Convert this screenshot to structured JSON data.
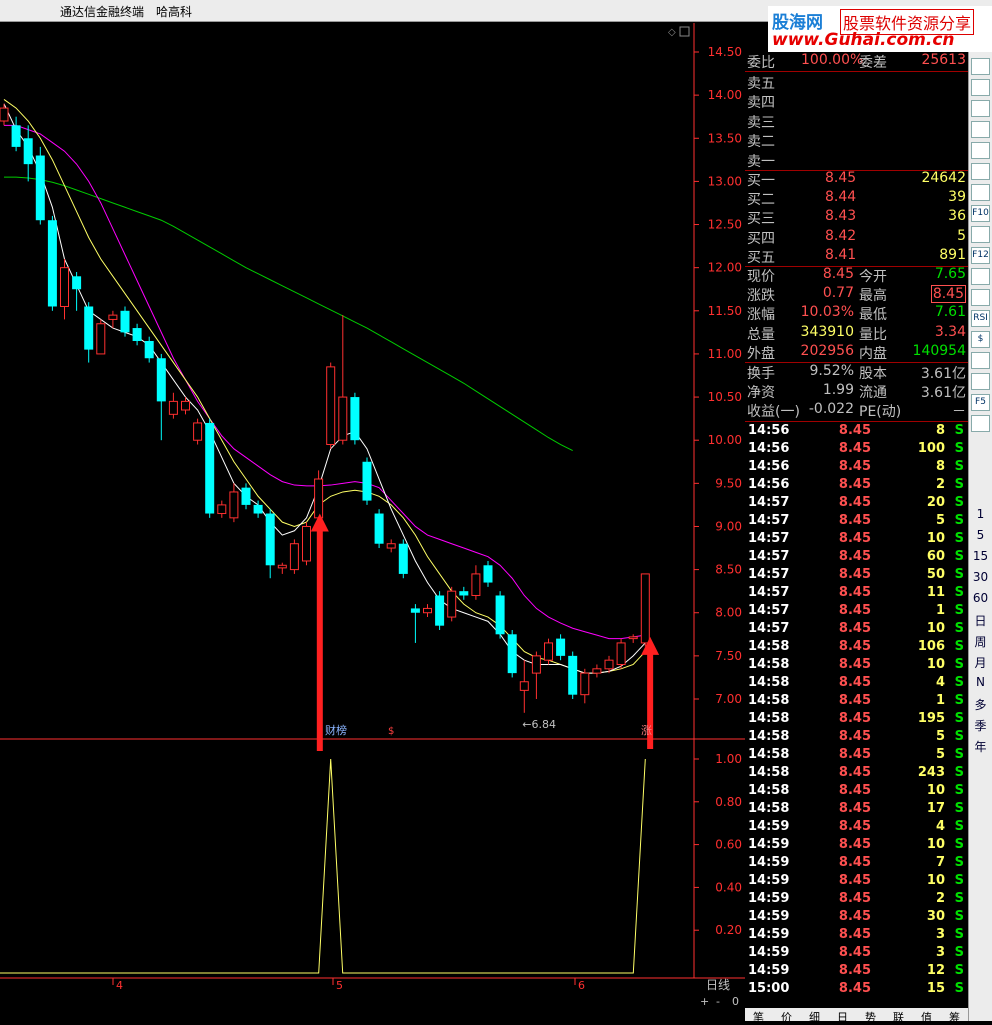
{
  "titlebar": {
    "app": "通达信金融终端",
    "stock": "哈高科"
  },
  "watermark": {
    "brand": "股海网",
    "tag": "股票软件资源分享",
    "url": "www.Guhai.com.cn"
  },
  "price_axis": [
    "14.50",
    "14.00",
    "13.50",
    "13.00",
    "12.50",
    "12.00",
    "11.50",
    "11.00",
    "10.50",
    "10.00",
    "9.50",
    "9.00",
    "8.50",
    "8.00",
    "7.50",
    "7.00"
  ],
  "indicator_axis": [
    "1.00",
    "0.80",
    "0.60",
    "0.40",
    "0.20"
  ],
  "date_axis": [
    "4",
    "5",
    "6"
  ],
  "period_label": "日线",
  "annotations": {
    "low_label": "←6.84",
    "signal_1": "财榜",
    "signal_2": "$",
    "signal_3": "涨"
  },
  "zoom_controls": {
    "plus": "+",
    "minus": "-",
    "zero": "0"
  },
  "quote": {
    "weibi": {
      "label": "委比",
      "value": "100.00%",
      "label2": "委差",
      "value2": "25613"
    },
    "sell": [
      {
        "label": "卖五"
      },
      {
        "label": "卖四"
      },
      {
        "label": "卖三"
      },
      {
        "label": "卖二"
      },
      {
        "label": "卖一"
      }
    ],
    "buy": [
      {
        "label": "买一",
        "price": "8.45",
        "vol": "24642"
      },
      {
        "label": "买二",
        "price": "8.44",
        "vol": "39"
      },
      {
        "label": "买三",
        "price": "8.43",
        "vol": "36"
      },
      {
        "label": "买四",
        "price": "8.42",
        "vol": "5"
      },
      {
        "label": "买五",
        "price": "8.41",
        "vol": "891"
      }
    ],
    "stats": [
      {
        "l1": "现价",
        "v1": "8.45",
        "l2": "今开",
        "v2": "7.65"
      },
      {
        "l1": "涨跌",
        "v1": "0.77",
        "l2": "最高",
        "v2": "8.45"
      },
      {
        "l1": "涨幅",
        "v1": "10.03%",
        "l2": "最低",
        "v2": "7.61"
      },
      {
        "l1": "总量",
        "v1": "343910",
        "l2": "量比",
        "v2": "3.34"
      },
      {
        "l1": "外盘",
        "v1": "202956",
        "l2": "内盘",
        "v2": "140954"
      }
    ],
    "fund": [
      {
        "l1": "换手",
        "v1": "9.52%",
        "l2": "股本",
        "v2": "3.61亿"
      },
      {
        "l1": "净资",
        "v1": "1.99",
        "l2": "流通",
        "v2": "3.61亿"
      },
      {
        "l1": "收益(一)",
        "v1": "-0.022",
        "l2": "PE(动)",
        "v2": "－"
      }
    ]
  },
  "ticks": [
    {
      "t": "14:56",
      "p": "8.45",
      "v": "8",
      "s": "S"
    },
    {
      "t": "14:56",
      "p": "8.45",
      "v": "100",
      "s": "S"
    },
    {
      "t": "14:56",
      "p": "8.45",
      "v": "8",
      "s": "S"
    },
    {
      "t": "14:56",
      "p": "8.45",
      "v": "2",
      "s": "S"
    },
    {
      "t": "14:57",
      "p": "8.45",
      "v": "20",
      "s": "S"
    },
    {
      "t": "14:57",
      "p": "8.45",
      "v": "5",
      "s": "S"
    },
    {
      "t": "14:57",
      "p": "8.45",
      "v": "10",
      "s": "S"
    },
    {
      "t": "14:57",
      "p": "8.45",
      "v": "60",
      "s": "S"
    },
    {
      "t": "14:57",
      "p": "8.45",
      "v": "50",
      "s": "S"
    },
    {
      "t": "14:57",
      "p": "8.45",
      "v": "11",
      "s": "S"
    },
    {
      "t": "14:57",
      "p": "8.45",
      "v": "1",
      "s": "S"
    },
    {
      "t": "14:57",
      "p": "8.45",
      "v": "10",
      "s": "S"
    },
    {
      "t": "14:58",
      "p": "8.45",
      "v": "106",
      "s": "S"
    },
    {
      "t": "14:58",
      "p": "8.45",
      "v": "10",
      "s": "S"
    },
    {
      "t": "14:58",
      "p": "8.45",
      "v": "4",
      "s": "S"
    },
    {
      "t": "14:58",
      "p": "8.45",
      "v": "1",
      "s": "S"
    },
    {
      "t": "14:58",
      "p": "8.45",
      "v": "195",
      "s": "S"
    },
    {
      "t": "14:58",
      "p": "8.45",
      "v": "5",
      "s": "S"
    },
    {
      "t": "14:58",
      "p": "8.45",
      "v": "5",
      "s": "S"
    },
    {
      "t": "14:58",
      "p": "8.45",
      "v": "243",
      "s": "S"
    },
    {
      "t": "14:58",
      "p": "8.45",
      "v": "10",
      "s": "S"
    },
    {
      "t": "14:58",
      "p": "8.45",
      "v": "17",
      "s": "S"
    },
    {
      "t": "14:59",
      "p": "8.45",
      "v": "4",
      "s": "S"
    },
    {
      "t": "14:59",
      "p": "8.45",
      "v": "10",
      "s": "S"
    },
    {
      "t": "14:59",
      "p": "8.45",
      "v": "7",
      "s": "S"
    },
    {
      "t": "14:59",
      "p": "8.45",
      "v": "10",
      "s": "S"
    },
    {
      "t": "14:59",
      "p": "8.45",
      "v": "2",
      "s": "S"
    },
    {
      "t": "14:59",
      "p": "8.45",
      "v": "30",
      "s": "S"
    },
    {
      "t": "14:59",
      "p": "8.45",
      "v": "3",
      "s": "S"
    },
    {
      "t": "14:59",
      "p": "8.45",
      "v": "3",
      "s": "S"
    },
    {
      "t": "14:59",
      "p": "8.45",
      "v": "12",
      "s": "S"
    },
    {
      "t": "15:00",
      "p": "8.45",
      "v": "15",
      "s": "S"
    }
  ],
  "toolbar": {
    "icons": [
      "refresh-icon",
      "kline-icon",
      "table-icon",
      "list-icon",
      "trend-icon",
      "chart-icon",
      "doc-icon",
      "f10-icon",
      "info-icon",
      "f12-icon",
      "circle-icon",
      "wave-icon",
      "rsi-icon",
      "money-icon",
      "move-icon",
      "pen-icon",
      "f5-icon",
      "cycle-icon"
    ],
    "icon_labels": [
      "",
      "",
      "",
      "",
      "",
      "",
      "",
      "F10",
      "",
      "F12",
      "",
      "",
      "RSI",
      "$",
      "",
      "",
      "F5",
      ""
    ],
    "periods": [
      "1",
      "5",
      "15",
      "30",
      "60",
      "日",
      "周",
      "月",
      "N",
      "多",
      "季",
      "年"
    ]
  },
  "bottom_tabs": [
    "笔",
    "价",
    "细",
    "日",
    "势",
    "联",
    "值",
    "筹"
  ],
  "chart_data": {
    "type": "candlestick",
    "ylim": [
      6.8,
      14.6
    ],
    "candles": [
      {
        "o": 13.7,
        "c": 13.85,
        "h": 13.9,
        "l": 13.65
      },
      {
        "o": 13.65,
        "c": 13.4,
        "h": 13.75,
        "l": 13.35
      },
      {
        "o": 13.5,
        "c": 13.2,
        "h": 13.65,
        "l": 13.0
      },
      {
        "o": 13.3,
        "c": 12.55,
        "h": 13.4,
        "l": 12.5
      },
      {
        "o": 12.55,
        "c": 11.55,
        "h": 12.6,
        "l": 11.5
      },
      {
        "o": 11.55,
        "c": 12.0,
        "h": 12.1,
        "l": 11.4
      },
      {
        "o": 11.9,
        "c": 11.75,
        "h": 11.95,
        "l": 11.5
      },
      {
        "o": 11.55,
        "c": 11.05,
        "h": 11.6,
        "l": 10.9
      },
      {
        "o": 11.0,
        "c": 11.35,
        "h": 11.4,
        "l": 11.0
      },
      {
        "o": 11.4,
        "c": 11.45,
        "h": 11.5,
        "l": 11.3
      },
      {
        "o": 11.5,
        "c": 11.25,
        "h": 11.55,
        "l": 11.2
      },
      {
        "o": 11.3,
        "c": 11.15,
        "h": 11.35,
        "l": 11.1
      },
      {
        "o": 11.15,
        "c": 10.95,
        "h": 11.2,
        "l": 10.9
      },
      {
        "o": 10.95,
        "c": 10.45,
        "h": 11.0,
        "l": 10.0
      },
      {
        "o": 10.3,
        "c": 10.45,
        "h": 10.55,
        "l": 10.25
      },
      {
        "o": 10.35,
        "c": 10.45,
        "h": 10.5,
        "l": 10.3
      },
      {
        "o": 10.0,
        "c": 10.2,
        "h": 10.25,
        "l": 9.95
      },
      {
        "o": 10.2,
        "c": 9.15,
        "h": 10.25,
        "l": 9.1
      },
      {
        "o": 9.15,
        "c": 9.25,
        "h": 9.3,
        "l": 9.1
      },
      {
        "o": 9.1,
        "c": 9.4,
        "h": 9.5,
        "l": 9.05
      },
      {
        "o": 9.45,
        "c": 9.25,
        "h": 9.5,
        "l": 9.2
      },
      {
        "o": 9.25,
        "c": 9.15,
        "h": 9.3,
        "l": 9.1
      },
      {
        "o": 9.15,
        "c": 8.55,
        "h": 9.2,
        "l": 8.4
      },
      {
        "o": 8.52,
        "c": 8.55,
        "h": 8.58,
        "l": 8.45
      },
      {
        "o": 8.5,
        "c": 8.8,
        "h": 8.85,
        "l": 8.45
      },
      {
        "o": 8.6,
        "c": 9.0,
        "h": 9.05,
        "l": 8.55
      },
      {
        "o": 9.1,
        "c": 9.55,
        "h": 9.65,
        "l": 9.05
      },
      {
        "o": 9.95,
        "c": 10.85,
        "h": 10.9,
        "l": 9.9
      },
      {
        "o": 10.0,
        "c": 10.5,
        "h": 11.45,
        "l": 9.95
      },
      {
        "o": 10.5,
        "c": 10.0,
        "h": 10.55,
        "l": 9.95
      },
      {
        "o": 9.75,
        "c": 9.3,
        "h": 9.8,
        "l": 9.25
      },
      {
        "o": 9.15,
        "c": 8.8,
        "h": 9.2,
        "l": 8.75
      },
      {
        "o": 8.75,
        "c": 8.8,
        "h": 8.85,
        "l": 8.7
      },
      {
        "o": 8.8,
        "c": 8.45,
        "h": 8.85,
        "l": 8.4
      },
      {
        "o": 8.05,
        "c": 8.0,
        "h": 8.1,
        "l": 7.65
      },
      {
        "o": 8.0,
        "c": 8.05,
        "h": 8.1,
        "l": 7.95
      },
      {
        "o": 8.2,
        "c": 7.85,
        "h": 8.25,
        "l": 7.8
      },
      {
        "o": 7.95,
        "c": 8.25,
        "h": 8.3,
        "l": 7.9
      },
      {
        "o": 8.25,
        "c": 8.2,
        "h": 8.3,
        "l": 8.15
      },
      {
        "o": 8.2,
        "c": 8.45,
        "h": 8.55,
        "l": 8.15
      },
      {
        "o": 8.55,
        "c": 8.35,
        "h": 8.6,
        "l": 8.3
      },
      {
        "o": 8.2,
        "c": 7.75,
        "h": 8.25,
        "l": 7.7
      },
      {
        "o": 7.75,
        "c": 7.3,
        "h": 7.8,
        "l": 7.25
      },
      {
        "o": 7.1,
        "c": 7.2,
        "h": 7.45,
        "l": 6.84
      },
      {
        "o": 7.3,
        "c": 7.5,
        "h": 7.55,
        "l": 7.0
      },
      {
        "o": 7.45,
        "c": 7.65,
        "h": 7.7,
        "l": 7.4
      },
      {
        "o": 7.7,
        "c": 7.5,
        "h": 7.75,
        "l": 7.45
      },
      {
        "o": 7.5,
        "c": 7.05,
        "h": 7.55,
        "l": 7.0
      },
      {
        "o": 7.05,
        "c": 7.3,
        "h": 7.35,
        "l": 6.95
      },
      {
        "o": 7.3,
        "c": 7.35,
        "h": 7.4,
        "l": 7.25
      },
      {
        "o": 7.35,
        "c": 7.45,
        "h": 7.5,
        "l": 7.3
      },
      {
        "o": 7.4,
        "c": 7.65,
        "h": 7.7,
        "l": 7.35
      },
      {
        "o": 7.7,
        "c": 7.72,
        "h": 7.75,
        "l": 7.65
      },
      {
        "o": 7.65,
        "c": 8.45,
        "h": 8.45,
        "l": 7.61
      }
    ],
    "ma_white": [
      13.9,
      13.6,
      13.4,
      13.1,
      12.7,
      12.1,
      11.8,
      11.5,
      11.4,
      11.3,
      11.25,
      11.2,
      11.1,
      10.9,
      10.7,
      10.5,
      10.35,
      10.1,
      9.8,
      9.5,
      9.35,
      9.25,
      9.05,
      8.9,
      8.95,
      9.1,
      9.45,
      9.9,
      10.05,
      10.1,
      9.9,
      9.55,
      9.2,
      8.9,
      8.6,
      8.35,
      8.15,
      8.05,
      8.0,
      7.95,
      7.9,
      7.75,
      7.55,
      7.45,
      7.4,
      7.4,
      7.4,
      7.35,
      7.3,
      7.3,
      7.32,
      7.38,
      7.5,
      7.65
    ],
    "ma_yellow": [
      13.95,
      13.85,
      13.7,
      13.5,
      13.25,
      12.95,
      12.65,
      12.35,
      12.1,
      11.9,
      11.7,
      11.5,
      11.3,
      11.1,
      10.9,
      10.7,
      10.5,
      10.25,
      10.0,
      9.75,
      9.55,
      9.35,
      9.2,
      9.05,
      9.0,
      9.05,
      9.25,
      9.35,
      9.4,
      9.42,
      9.4,
      9.35,
      9.25,
      9.1,
      8.9,
      8.65,
      8.45,
      8.25,
      8.1,
      8.0,
      7.95,
      7.85,
      7.7,
      7.55,
      7.48,
      7.45,
      7.4,
      7.35,
      7.3,
      7.3,
      7.32,
      7.35,
      7.4,
      7.55
    ],
    "ma_magenta": [
      13.65,
      13.65,
      13.6,
      13.55,
      13.45,
      13.35,
      13.2,
      13.0,
      12.75,
      12.45,
      12.15,
      11.85,
      11.55,
      11.25,
      10.95,
      10.7,
      10.45,
      10.25,
      10.05,
      9.9,
      9.8,
      9.7,
      9.6,
      9.52,
      9.48,
      9.47,
      9.47,
      9.48,
      9.5,
      9.52,
      9.5,
      9.45,
      9.3,
      9.15,
      9.0,
      8.9,
      8.85,
      8.8,
      8.75,
      8.7,
      8.65,
      8.55,
      8.4,
      8.2,
      8.05,
      7.95,
      7.88,
      7.82,
      7.78,
      7.74,
      7.7,
      7.7,
      7.72,
      7.74
    ],
    "ma_green": [
      13.05,
      13.05,
      13.04,
      13.02,
      12.99,
      12.95,
      12.9,
      12.85,
      12.8,
      12.75,
      12.7,
      12.65,
      12.6,
      12.55,
      12.48,
      12.4,
      12.32,
      12.24,
      12.16,
      12.08,
      12.0,
      11.93,
      11.86,
      11.79,
      11.72,
      11.65,
      11.58,
      11.51,
      11.44,
      11.37,
      11.3,
      11.22,
      11.14,
      11.06,
      10.98,
      10.9,
      10.82,
      10.74,
      10.66,
      10.57,
      10.48,
      10.39,
      10.3,
      10.21,
      10.12,
      10.03,
      9.95,
      9.88
    ],
    "signal": {
      "signal_index": [
        27,
        53
      ],
      "ylim": [
        0,
        1
      ]
    }
  }
}
